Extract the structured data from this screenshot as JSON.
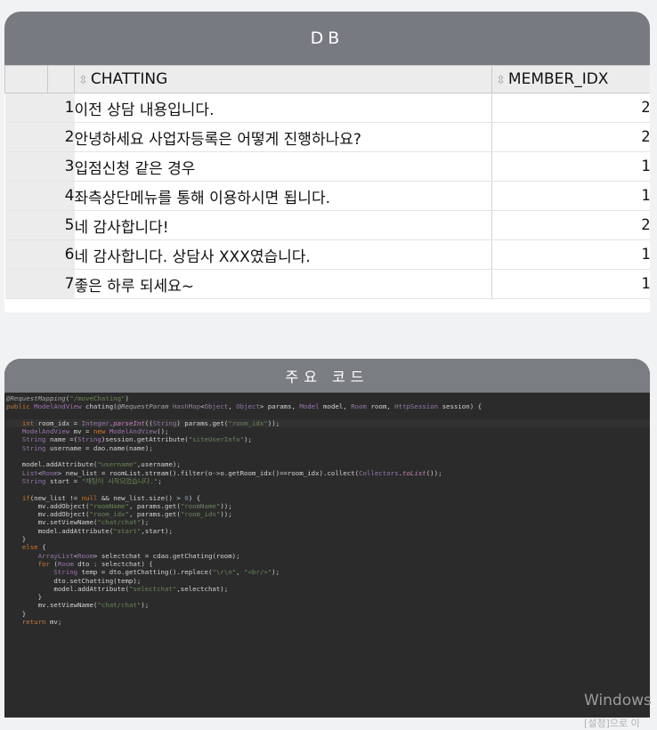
{
  "db_panel": {
    "title": "DB",
    "columns": [
      "CHATTING",
      "MEMBER_IDX"
    ],
    "rows": [
      {
        "num": "1",
        "chatting": "이전 상담 내용입니다.",
        "member_idx": "2"
      },
      {
        "num": "2",
        "chatting": "안녕하세요 사업자등록은 어떻게 진행하나요?",
        "member_idx": "2"
      },
      {
        "num": "3",
        "chatting": "입점신청 같은 경우",
        "member_idx": "1"
      },
      {
        "num": "4",
        "chatting": "좌측상단메뉴를 통해 이용하시면 됩니다.",
        "member_idx": "1"
      },
      {
        "num": "5",
        "chatting": "네 감사합니다!",
        "member_idx": "2"
      },
      {
        "num": "6",
        "chatting": "네 감사합니다. 상담사 XXX였습니다.",
        "member_idx": "1"
      },
      {
        "num": "7",
        "chatting": "좋은 하루 되세요~",
        "member_idx": "1"
      }
    ]
  },
  "code_panel": {
    "title": "주요 코드",
    "lines": [
      "@RequestMapping(\"/moveChating\")",
      "public ModelAndView chating(@RequestParam HashMap<Object, Object> params, Model model, Room room, HttpSession session) {",
      "",
      "    int room_idx = Integer.parseInt((String) params.get(\"room_idx\"));",
      "    ModelAndView mv = new ModelAndView();",
      "    String name =(String)session.getAttribute(\"siteUserInfo\");",
      "    String username = dao.name(name);",
      "",
      "    model.addAttribute(\"username\",username);",
      "    List<Room> new_list = roomList.stream().filter(o->o.getRoom_idx()==room_idx).collect(Collectors.toList());",
      "    String start = \"채팅이 시작되었습니다.\";",
      "",
      "    if(new_list != null && new_list.size() > 0) {",
      "        mv.addObject(\"roomName\", params.get(\"roomName\"));",
      "        mv.addObject(\"room_idx\", params.get(\"room_idx\"));",
      "        mv.setViewName(\"chat/chat\");",
      "        model.addAttribute(\"start\",start);",
      "    }",
      "    else {",
      "        ArrayList<Room> selectchat = cdao.getChating(room);",
      "        for (Room dto : selectchat) {",
      "            String temp = dto.getChatting().replace(\"\\r\\n\", \"<br/>\");",
      "            dto.setChatting(temp);",
      "            model.addAttribute(\"selectchat\",selectchat);",
      "        }",
      "        mv.setViewName(\"chat/chat\");",
      "    }",
      "    return mv;"
    ]
  },
  "watermark": {
    "line1": "Windows",
    "line2": "[설정]으로 이"
  }
}
